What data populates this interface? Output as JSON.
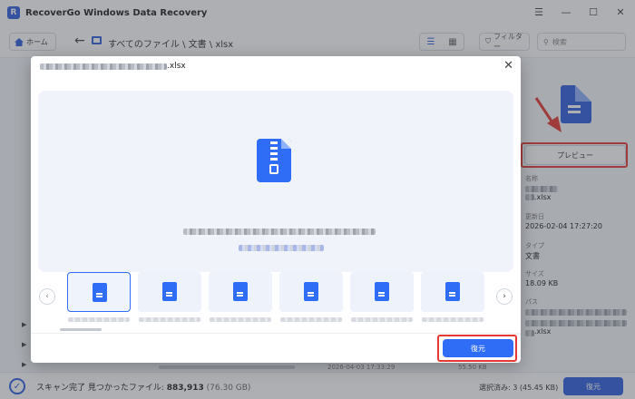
{
  "app": {
    "title": "RecoverGo Windows Data Recovery",
    "logo_letter": "R",
    "window_controls": [
      "☰",
      "—",
      "☐",
      "✕"
    ]
  },
  "nav": {
    "home_label": "ホーム",
    "path": "すべてのファイル \\ 文書 \\ xlsx",
    "filter_label": "フィルター",
    "search_placeholder": "検索"
  },
  "details": {
    "preview_button": "プレビュー",
    "name_label": "名称",
    "name_value": ".xlsx",
    "updated_label": "更新日",
    "updated_value": "2026-02-04 17:27:20",
    "type_label": "タイプ",
    "type_value": "文書",
    "size_label": "サイズ",
    "size_value": "18.09 KB",
    "path_label": "パス",
    "path_value": ".xlsx"
  },
  "background_row": {
    "date": "2026-04-03 17:33:29",
    "size": "55.50 KB"
  },
  "status": {
    "prefix": "スキャン完了 見つかったファイル: ",
    "count": "883,913",
    "size": "(76.30 GB)",
    "selected": "選択済み: 3 (45.45 KB)",
    "recover_button": "復元"
  },
  "modal": {
    "title_suffix": ".xlsx",
    "close_icon": "✕",
    "prev_icon": "‹",
    "next_icon": "›",
    "recover_button": "復元",
    "thumbnail_count": 6
  },
  "colors": {
    "accent": "#2f6df6",
    "highlight": "#e53935"
  }
}
